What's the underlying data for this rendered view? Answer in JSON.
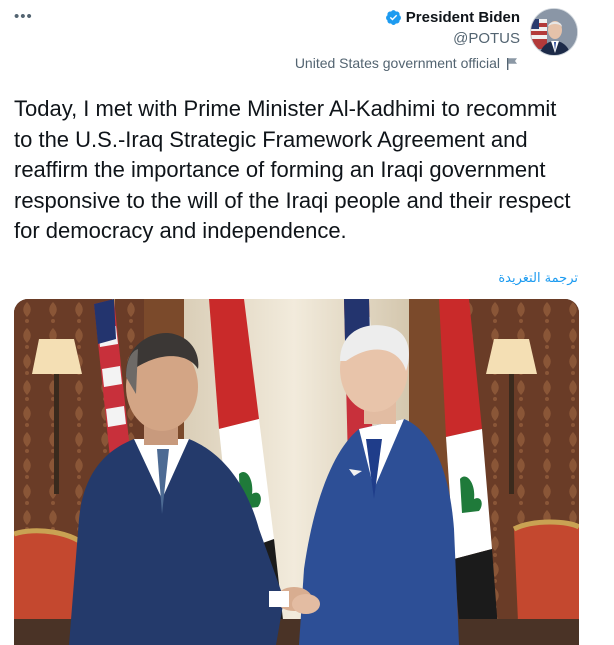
{
  "header": {
    "more_icon": "more-horizontal-icon",
    "display_name": "President Biden",
    "handle": "@POTUS",
    "verified_icon": "verified-badge-icon",
    "affiliation_label": "United States government official",
    "affiliation_icon": "flag-icon"
  },
  "tweet": {
    "text": "Today, I met with Prime Minister Al-Kadhimi to recommit to the U.S.-Iraq Strategic Framework Agreement and reaffirm the importance of forming an Iraqi government responsive to the will of the Iraqi people and their respect for democracy and independence.",
    "translate_label": "ترجمة التغريدة"
  },
  "colors": {
    "accent": "#1d9bf0",
    "muted": "#536471",
    "text": "#0f1419"
  }
}
